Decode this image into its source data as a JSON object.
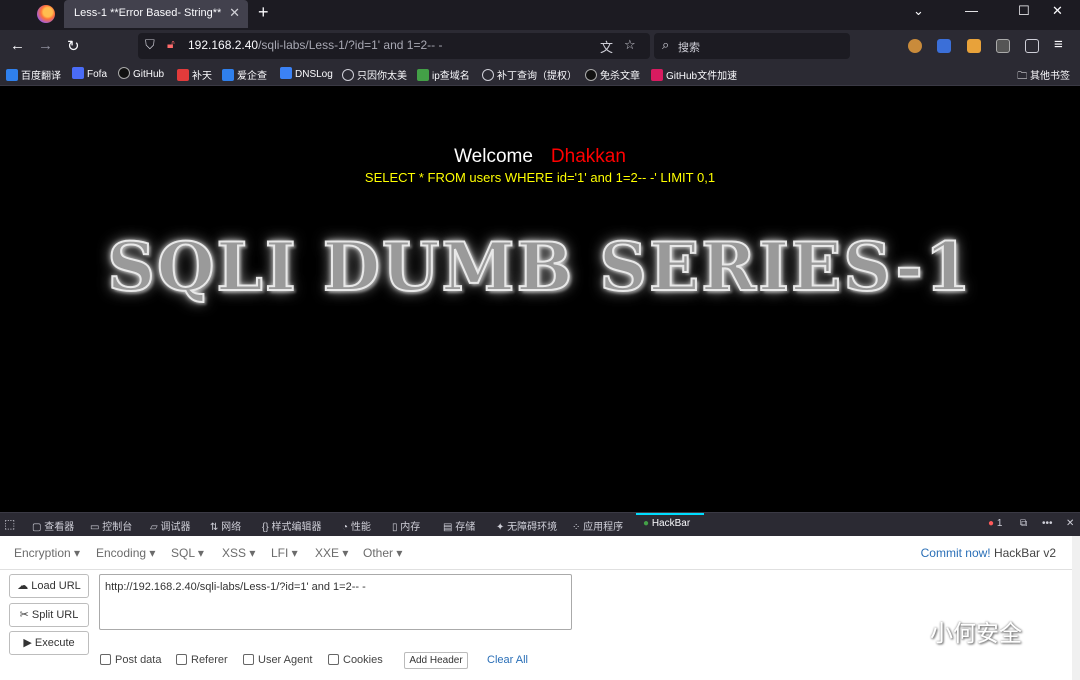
{
  "browser": {
    "tab_title": "Less-1 **Error Based- String**",
    "tab_close": "✕",
    "new_tab": "+",
    "url_host": "192.168.2.40",
    "url_path": "/sqli-labs/Less-1/?id=1' and 1=2-- -",
    "search_placeholder": "搜索",
    "controls": {
      "chevron": "⌄",
      "minimize": "—",
      "maximize": "☐",
      "close": "✕"
    },
    "nav": {
      "back": "←",
      "forward": "→",
      "reload": "↻",
      "menu": "≡"
    }
  },
  "bookmarks": [
    {
      "label": "百度翻译",
      "color": "#2f80ed"
    },
    {
      "label": "Fofa",
      "color": "#4a6cf7"
    },
    {
      "label": "GitHub",
      "color": "#111111"
    },
    {
      "label": "补天",
      "color": "#e23b3b"
    },
    {
      "label": "爱企查",
      "color": "#2f80ed"
    },
    {
      "label": "DNSLog",
      "color": "#3b82f6"
    },
    {
      "label": "只因你太美",
      "color": "#cfcfd8"
    },
    {
      "label": "ip查域名",
      "color": "#43a047"
    },
    {
      "label": "补丁查询（提权）",
      "color": "#cfcfd8"
    },
    {
      "label": "免杀文章",
      "color": "#111111"
    },
    {
      "label": "GitHub文件加速",
      "color": "#d81b60"
    }
  ],
  "bookmarks_other": "其他书签",
  "page": {
    "welcome": "Welcome",
    "username": "Dhakkan",
    "query": "SELECT * FROM users WHERE id='1' and 1=2-- -' LIMIT 0,1",
    "banner": "SQLI DUMB SERIES-1"
  },
  "devtools": {
    "tabs": [
      "查看器",
      "控制台",
      "调试器",
      "网络",
      "样式编辑器",
      "性能",
      "内存",
      "存储",
      "无障碍环境",
      "应用程序",
      "HackBar"
    ],
    "error_count": "1",
    "more": "•••",
    "close": "✕"
  },
  "hackbar": {
    "menus": [
      "Encryption ▾",
      "Encoding ▾",
      "SQL ▾",
      "XSS ▾",
      "LFI ▾",
      "XXE ▾",
      "Other ▾"
    ],
    "commit_link": "Commit now!",
    "commit_version": "HackBar v2",
    "load_url": "Load URL",
    "split_url": "Split URL",
    "execute": "Execute",
    "url_value": "http://192.168.2.40/sqli-labs/Less-1/?id=1' and 1=2-- -",
    "checkboxes": [
      "Post data",
      "Referer",
      "User Agent",
      "Cookies"
    ],
    "add_header": "Add Header",
    "clear_all": "Clear All"
  },
  "watermark": "小何安全"
}
